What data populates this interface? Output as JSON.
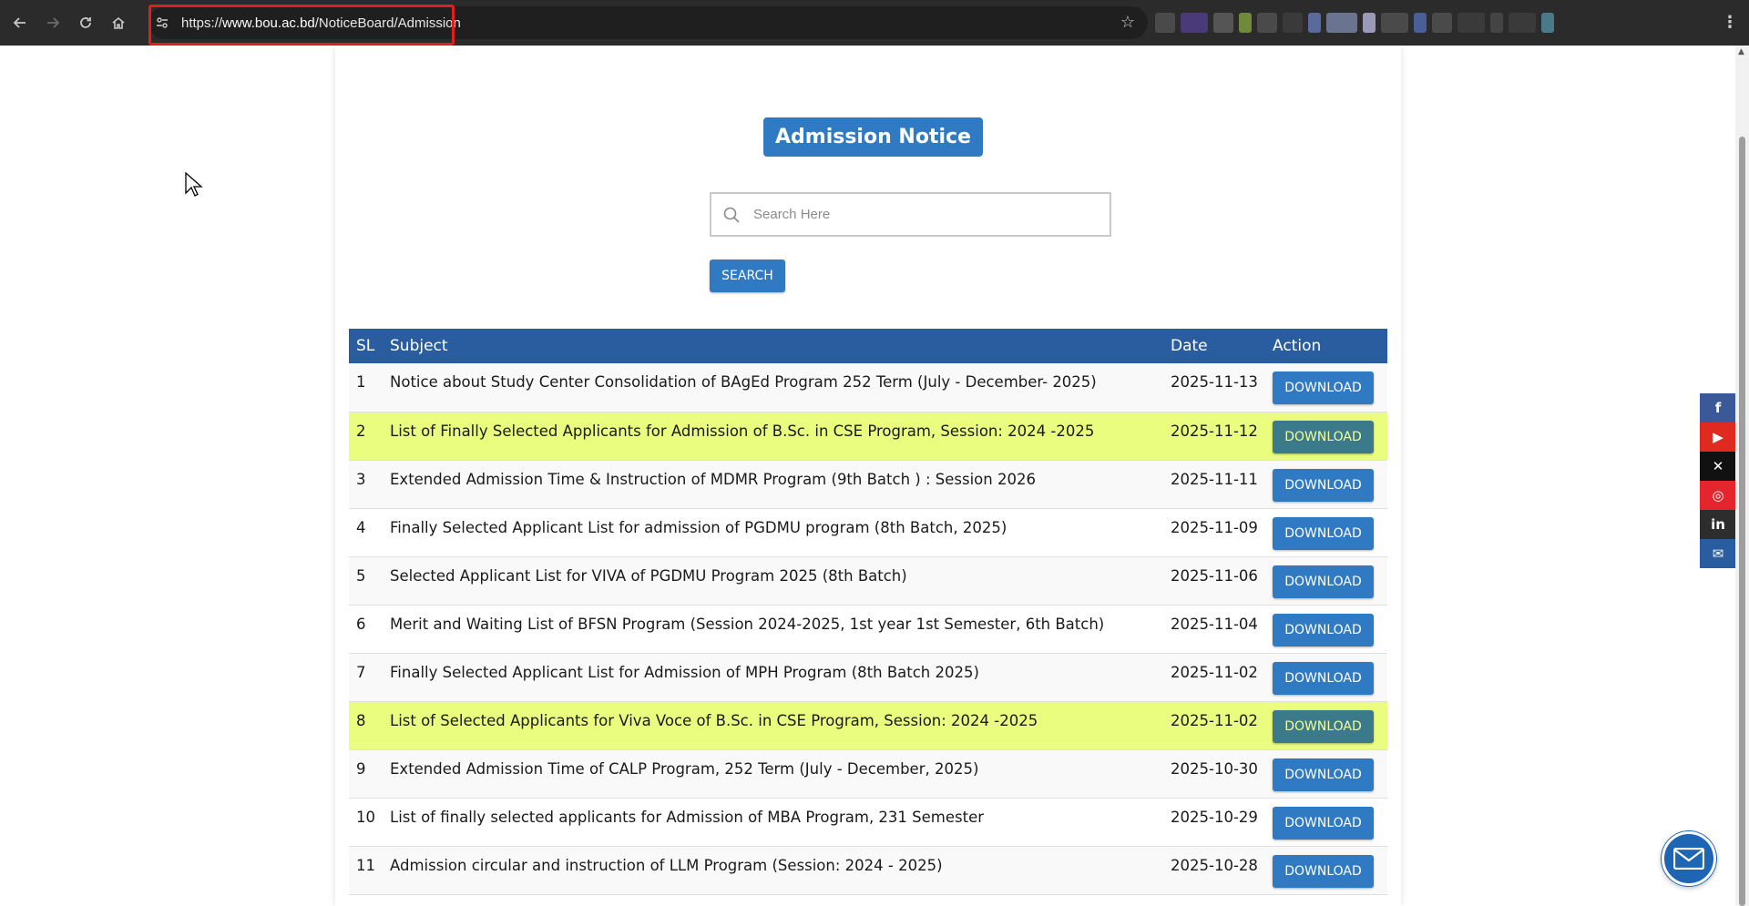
{
  "browser": {
    "url_prefix": "https://",
    "url_host": "www.bou.ac.bd",
    "url_path": "/NoticeBoard/Admission"
  },
  "page": {
    "title": "Admission Notice",
    "search_placeholder": "Search Here",
    "search_button": "SEARCH"
  },
  "table": {
    "headers": {
      "sl": "SL",
      "subject": "Subject",
      "date": "Date",
      "action": "Action"
    },
    "rows": [
      {
        "sl": "1",
        "subject": "Notice about Study Center Consolidation of BAgEd Program 252 Term (July - December- 2025)",
        "date": "2025-11-13",
        "action": "DOWNLOAD"
      },
      {
        "sl": "2",
        "subject": "List of Finally Selected Applicants for Admission of B.Sc. in CSE Program, Session: 2024 -2025",
        "date": "2025-11-12",
        "action": "DOWNLOAD"
      },
      {
        "sl": "3",
        "subject": "Extended Admission Time & Instruction of MDMR Program (9th Batch ) : Session 2026",
        "date": "2025-11-11",
        "action": "DOWNLOAD"
      },
      {
        "sl": "4",
        "subject": "Finally Selected Applicant List for admission of PGDMU program (8th Batch, 2025)",
        "date": "2025-11-09",
        "action": "DOWNLOAD"
      },
      {
        "sl": "5",
        "subject": "Selected Applicant List for VIVA of PGDMU Program 2025 (8th Batch)",
        "date": "2025-11-06",
        "action": "DOWNLOAD"
      },
      {
        "sl": "6",
        "subject": "Merit and Waiting List of BFSN Program (Session 2024-2025, 1st year 1st Semester, 6th Batch)",
        "date": "2025-11-04",
        "action": "DOWNLOAD"
      },
      {
        "sl": "7",
        "subject": "Finally Selected Applicant List for Admission of MPH Program (8th Batch 2025)",
        "date": "2025-11-02",
        "action": "DOWNLOAD"
      },
      {
        "sl": "8",
        "subject": "List of Selected Applicants for Viva Voce of B.Sc. in CSE Program, Session: 2024 -2025",
        "date": "2025-11-02",
        "action": "DOWNLOAD"
      },
      {
        "sl": "9",
        "subject": "Extended Admission Time of CALP Program, 252 Term (July - December, 2025)",
        "date": "2025-10-30",
        "action": "DOWNLOAD"
      },
      {
        "sl": "10",
        "subject": "List of finally selected applicants for Admission of MBA Program, 231 Semester",
        "date": "2025-10-29",
        "action": "DOWNLOAD"
      },
      {
        "sl": "11",
        "subject": "Admission circular and instruction of LLM Program (Session: 2024 - 2025)",
        "date": "2025-10-28",
        "action": "DOWNLOAD"
      }
    ]
  },
  "social": [
    {
      "icon": "facebook-icon",
      "glyph": "f",
      "color": "#3b5998"
    },
    {
      "icon": "youtube-icon",
      "glyph": "▶",
      "color": "#e02a20"
    },
    {
      "icon": "x-icon",
      "glyph": "✕",
      "color": "#111111"
    },
    {
      "icon": "instagram-icon",
      "glyph": "◎",
      "color": "#e4252d"
    },
    {
      "icon": "linkedin-icon",
      "glyph": "in",
      "color": "#2d2d2d"
    },
    {
      "icon": "email-icon",
      "glyph": "✉",
      "color": "#2a5d9f"
    }
  ],
  "colors": {
    "primary": "#2f7ac2",
    "header": "#2a5d9f",
    "highlight": "#ebfd7f"
  }
}
